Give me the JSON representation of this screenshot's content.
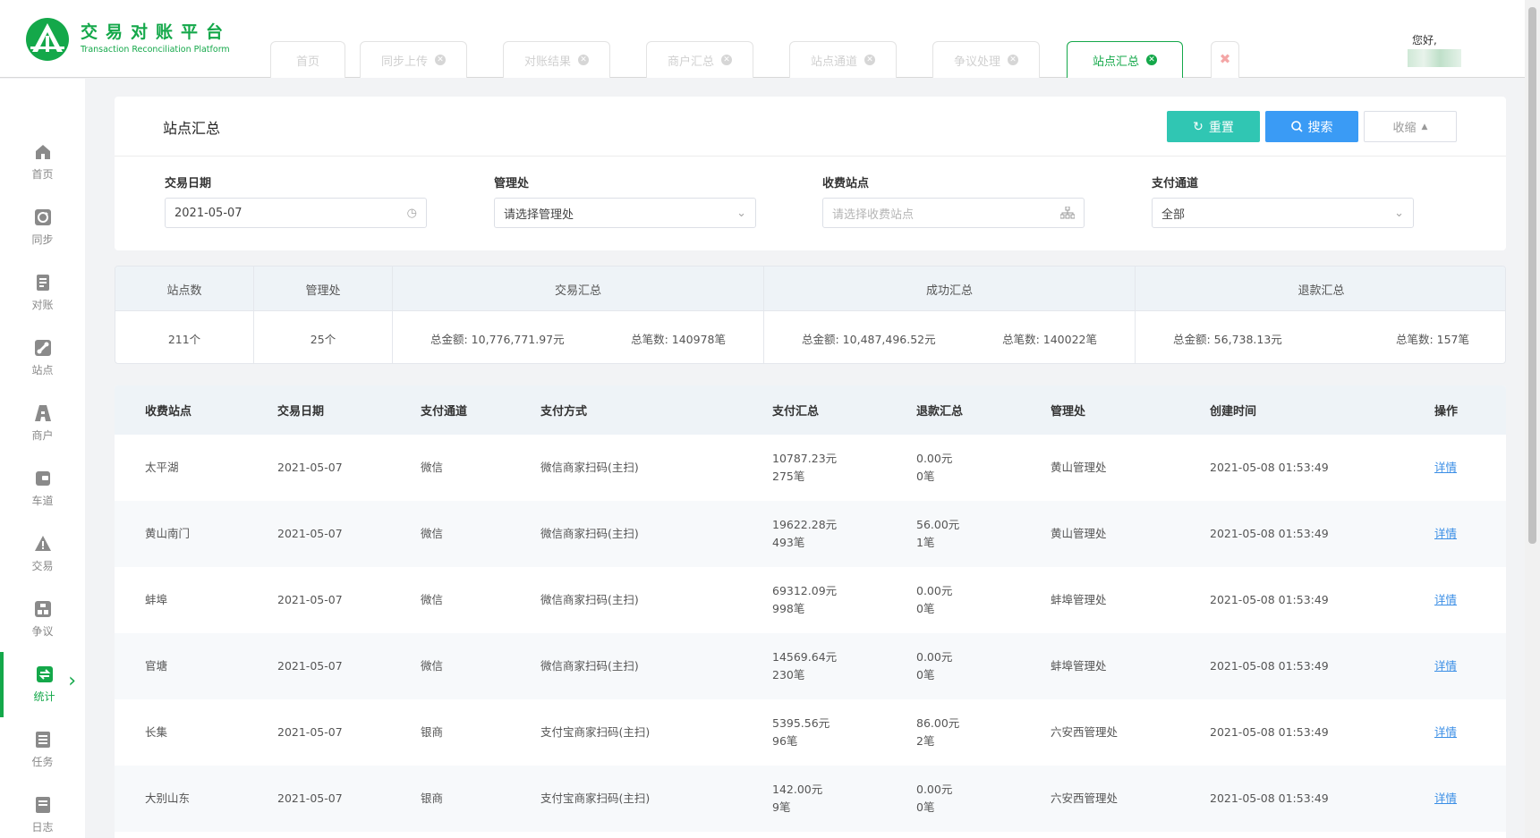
{
  "brand": {
    "name_cn": "交易对账平台",
    "name_en": "Transaction Reconciliation Platform",
    "color": "#14a84a"
  },
  "tabs": [
    {
      "label": "首页",
      "closable": false
    },
    {
      "label": "同步上传",
      "closable": true
    },
    {
      "label": "对账结果",
      "closable": true
    },
    {
      "label": "商户汇总",
      "closable": true
    },
    {
      "label": "站点通道",
      "closable": true
    },
    {
      "label": "争议处理",
      "closable": true
    },
    {
      "label": "站点汇总",
      "closable": true,
      "active": true
    }
  ],
  "tab_close_all": "✖",
  "user": {
    "greeting": "您好,"
  },
  "sidebar": {
    "items": [
      {
        "label": "首页",
        "icon": "home-icon"
      },
      {
        "label": "同步",
        "icon": "sync-icon"
      },
      {
        "label": "对账",
        "icon": "reconcile-icon"
      },
      {
        "label": "站点",
        "icon": "station-icon"
      },
      {
        "label": "商户",
        "icon": "merchant-icon"
      },
      {
        "label": "车道",
        "icon": "lane-icon"
      },
      {
        "label": "交易",
        "icon": "warning-icon"
      },
      {
        "label": "争议",
        "icon": "dispute-icon"
      },
      {
        "label": "统计",
        "icon": "stats-icon",
        "active": true
      },
      {
        "label": "任务",
        "icon": "task-icon"
      },
      {
        "label": "日志",
        "icon": "log-icon"
      }
    ]
  },
  "filter": {
    "title": "站点汇总",
    "buttons": {
      "reset": "重置",
      "search": "搜索",
      "collapse": "收缩"
    },
    "fields": {
      "date": {
        "label": "交易日期",
        "value": "2021-05-07"
      },
      "office": {
        "label": "管理处",
        "value": "请选择管理处"
      },
      "station": {
        "label": "收费站点",
        "placeholder": "请选择收费站点"
      },
      "channel": {
        "label": "支付通道",
        "value": "全部"
      }
    }
  },
  "summary": {
    "headers": {
      "stations": "站点数",
      "offices": "管理处",
      "trade": "交易汇总",
      "success": "成功汇总",
      "refund": "退款汇总"
    },
    "values": {
      "stations": "211个",
      "offices": "25个",
      "trade_amount": "总金额: 10,776,771.97元",
      "trade_count": "总笔数: 140978笔",
      "success_amount": "总金额: 10,487,496.52元",
      "success_count": "总笔数: 140022笔",
      "refund_amount": "总金额: 56,738.13元",
      "refund_count": "总笔数: 157笔"
    }
  },
  "table": {
    "headers": {
      "station": "收费站点",
      "date": "交易日期",
      "channel": "支付通道",
      "method": "支付方式",
      "pay": "支付汇总",
      "refund": "退款汇总",
      "office": "管理处",
      "created": "创建时间",
      "action": "操作"
    },
    "rows": [
      {
        "station": "太平湖",
        "date": "2021-05-07",
        "channel": "微信",
        "method": "微信商家扫码(主扫)",
        "pay_amount": "10787.23元",
        "pay_count": "275笔",
        "refund_amount": "0.00元",
        "refund_count": "0笔",
        "office": "黄山管理处",
        "created": "2021-05-08 01:53:49",
        "action": "详情"
      },
      {
        "station": "黄山南门",
        "date": "2021-05-07",
        "channel": "微信",
        "method": "微信商家扫码(主扫)",
        "pay_amount": "19622.28元",
        "pay_count": "493笔",
        "refund_amount": "56.00元",
        "refund_count": "1笔",
        "office": "黄山管理处",
        "created": "2021-05-08 01:53:49",
        "action": "详情"
      },
      {
        "station": "蚌埠",
        "date": "2021-05-07",
        "channel": "微信",
        "method": "微信商家扫码(主扫)",
        "pay_amount": "69312.09元",
        "pay_count": "998笔",
        "refund_amount": "0.00元",
        "refund_count": "0笔",
        "office": "蚌埠管理处",
        "created": "2021-05-08 01:53:49",
        "action": "详情"
      },
      {
        "station": "官塘",
        "date": "2021-05-07",
        "channel": "微信",
        "method": "微信商家扫码(主扫)",
        "pay_amount": "14569.64元",
        "pay_count": "230笔",
        "refund_amount": "0.00元",
        "refund_count": "0笔",
        "office": "蚌埠管理处",
        "created": "2021-05-08 01:53:49",
        "action": "详情"
      },
      {
        "station": "长集",
        "date": "2021-05-07",
        "channel": "银商",
        "method": "支付宝商家扫码(主扫)",
        "pay_amount": "5395.56元",
        "pay_count": "96笔",
        "refund_amount": "86.00元",
        "refund_count": "2笔",
        "office": "六安西管理处",
        "created": "2021-05-08 01:53:49",
        "action": "详情"
      },
      {
        "station": "大别山东",
        "date": "2021-05-07",
        "channel": "银商",
        "method": "支付宝商家扫码(主扫)",
        "pay_amount": "142.00元",
        "pay_count": "9笔",
        "refund_amount": "0.00元",
        "refund_count": "0笔",
        "office": "六安西管理处",
        "created": "2021-05-08 01:53:49",
        "action": "详情"
      }
    ]
  }
}
